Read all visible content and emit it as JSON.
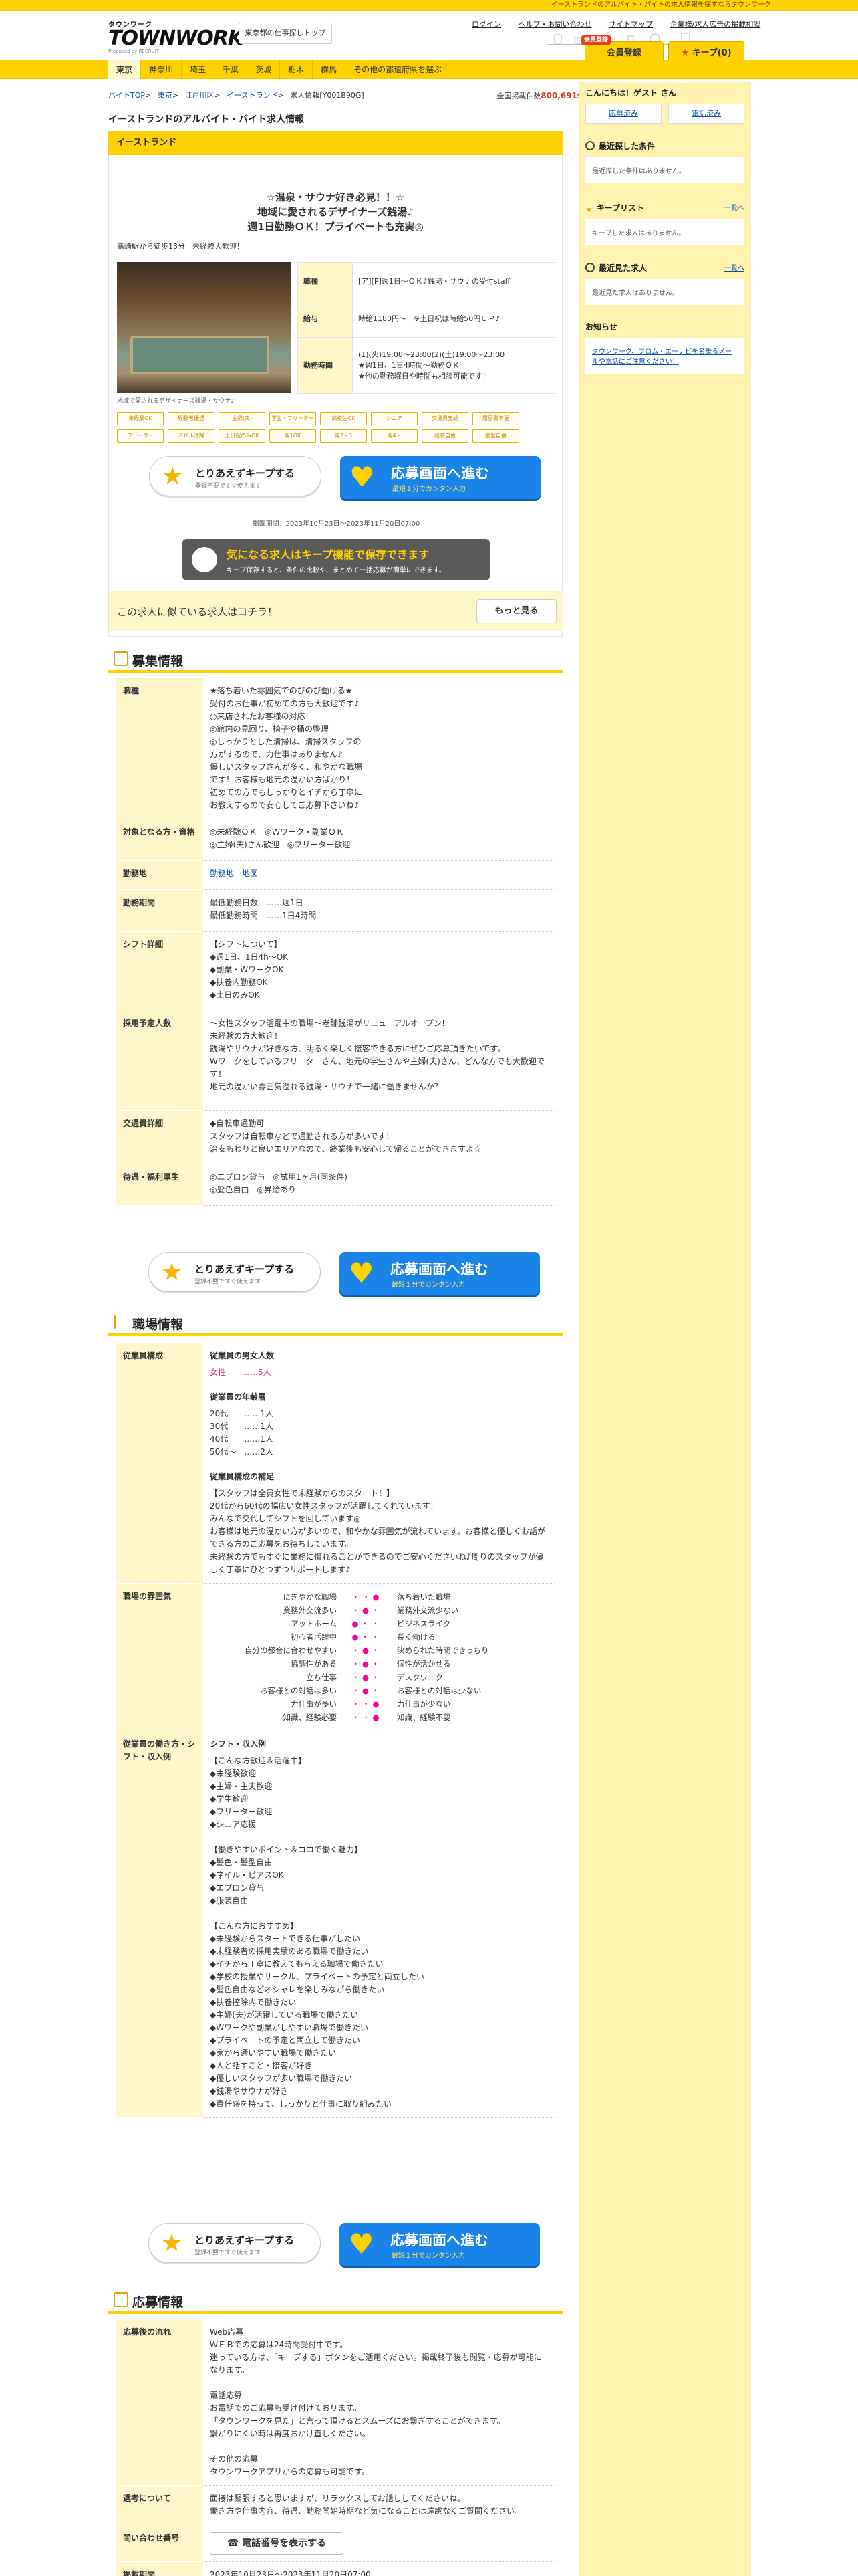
{
  "topbar": {
    "text": "イーストランドのアルバイト・パイトの求人情報を探すならタウンワーク"
  },
  "header": {
    "logo_top": "タウンワーク",
    "logo_main": "TOWNWORK",
    "logo_sub": "Produced by RECRUIT",
    "area_button": "東京都の仕事探しトップ",
    "links": [
      "ログイン",
      "ヘルプ・お問い合わせ",
      "サイトマップ",
      "企業様/求人広告の掲載相談"
    ],
    "register_badge": "会員登録",
    "register": "会員登録",
    "keep": "キープ(0)"
  },
  "nav": {
    "items": [
      "東京",
      "神奈川",
      "埼玉",
      "千葉",
      "茨城",
      "栃木",
      "群馬",
      "その他の都道府県を選ぶ"
    ]
  },
  "breadcrumb": [
    "バイトTOP",
    "東京",
    "江戸川区",
    "イーストランド",
    "求人情報[Y001B90G]"
  ],
  "count": {
    "label": "全国掲載件数",
    "value": "800,691件"
  },
  "page_title": "イーストランドのアルバイト・バイト求人情報",
  "job": {
    "company": "イーストランド",
    "headline": "☆温泉・サウナ好き必見！！☆\n地域に愛されるデザイナーズ銭湯♪\n週1日勤務ＯＫ！プライベートも充実◎",
    "location": "篠崎駅から徒歩13分　未経験大歓迎！",
    "photo_caption": "地域で愛されるデザイナーズ銭湯・サウナ♪",
    "summary": [
      {
        "label": "職種",
        "value": "[ア][P]週1日～ＯＫ♪銭湯・サウナの受付staff"
      },
      {
        "label": "給与",
        "value": "時給1180円～　※土日祝は時給50円ＵＰ♪"
      },
      {
        "label": "勤務時間",
        "value": "(1)(火)19:00～23:00(2)(土)19:00～23:00\n★週1日、1日4時間～勤務ＯＫ\n★他の勤務曜日や時間も相談可能です！"
      }
    ],
    "tags": [
      "未経験OK",
      "経験者優遇",
      "主婦(夫)",
      "学生・フリーター",
      "高校生OK",
      "シニア",
      "交通費支給",
      "履歴書不要",
      "フリーター",
      "ミドル活躍",
      "土日祝のみOK",
      "週1OK",
      "週2・3",
      "週4・",
      "服装自由",
      "髪型自由"
    ],
    "keep_button": "とりあえずキープする",
    "keep_sub": "登録不要ですぐ使えます",
    "apply_button": "応募画面へ進む",
    "apply_sub": "最短１分でカンタン入力",
    "published": "掲載期間：2023年10月23日～2023年11月20日07:00",
    "keep_banner_title": "気になる求人はキープ機能で保存できます",
    "keep_banner_sub": "キープ保存すると、条件の比較や、まとめて一括応募が簡単にできます。",
    "similar": "この求人に似ている求人はコチラ！",
    "similar_more": "もっと見る"
  },
  "recruit": {
    "title": "募集情報",
    "rows": [
      {
        "label": "職種",
        "value": "★落ち着いた雰囲気でのびのび働ける★\n受付のお仕事が初めての方も大歓迎です♪\n◎来店されたお客様の対応\n◎館内の見回り、椅子や桶の整理\n◎しっかりとした清掃は、清掃スタッフの\n方がするので、力仕事はありません♪\n優しいスタッフさんが多く、和やかな職場\nです！お客様も地元の温かい方ばかり！\n初めての方でもしっかりとイチから丁寧に\nお教えするので安心してご応募下さいね♪"
      },
      {
        "label": "対象となる方・資格",
        "value": "◎未経験ＯＫ　◎Ｗワーク・副業ＯＫ\n◎主婦(夫)さん歓迎　◎フリーター歓迎"
      },
      {
        "label": "勤務地",
        "value": "勤務地　地図"
      },
      {
        "label": "勤務期間",
        "value": "最低勤務日数　……週1日\n最低勤務時間　……1日4時間"
      },
      {
        "label": "シフト詳細",
        "value": "【シフトについて】\n◆週1日、1日4h～OK\n◆副業・WワークOK\n◆扶養内勤務OK\n◆土日のみOK"
      },
      {
        "label": "採用予定人数",
        "value": "～女性スタッフ活躍中の職場～老舗銭湯がリニューアルオープン！\n未経験の方大歓迎！\n銭湯やサウナが好きな方、明るく楽しく接客できる方にぜひご応募頂きたいです。\nWワークをしているフリーターさん、地元の学生さんや主婦(夫)さん、どんな方でも大歓迎です！\n地元の温かい雰囲気溢れる銭湯・サウナで一緒に働きませんか？"
      },
      {
        "label": "交通費詳細",
        "value": "◆自転車通勤可\nスタッフは自転車などで通勤される方が多いです！\n治安もわりと良いエリアなので、終業後も安心して帰ることができますよ☆"
      },
      {
        "label": "待遇・福利厚生",
        "value": "◎エプロン貸与　◎試用1ヶ月(同条件)\n◎髪色自由　◎昇給あり"
      }
    ]
  },
  "workplace": {
    "title": "職場情報",
    "staff_label": "従業員構成",
    "gender_title": "従業員の男女人数",
    "gender": "女性　　……5人",
    "age_title": "従業員の年齢層",
    "ages": "20代　　……1人\n30代　　……1人\n40代　　……1人\n50代～　……2人",
    "supp_title": "従業員構成の補足",
    "supp": "【スタッフは全員女性で未経験からのスタート！】\n20代から60代の幅広い女性スタッフが活躍してくれています！\nみんなで交代してシフトを回しています◎\nお客様は地元の温かい方が多いので、和やかな雰囲気が流れています。お客様と優しくお話ができる方のご応募をお待ちしています。\n未経験の方でもすぐに業務に慣れることができるのでご安心くださいね♪周りのスタッフが優しく丁寧にひとつずつサポートします♪",
    "atm_label": "職場の雰囲気",
    "atm": [
      {
        "l": "にぎやかな職場",
        "r": "落ち着いた職場"
      },
      {
        "l": "業務外交流多い",
        "r": "業務外交流少ない"
      },
      {
        "l": "アットホーム",
        "r": "ビジネスライク"
      },
      {
        "l": "初心者活躍中",
        "r": "長く働ける"
      },
      {
        "l": "自分の都合に合わせやすい",
        "r": "決められた時間できっちり"
      },
      {
        "l": "協調性がある",
        "r": "個性が活かせる"
      },
      {
        "l": "立ち仕事",
        "r": "デスクワーク"
      },
      {
        "l": "お客様との対話は多い",
        "r": "お客様との対話は少ない"
      },
      {
        "l": "力仕事が多い",
        "r": "力仕事が少ない"
      },
      {
        "l": "知識、経験必要",
        "r": "知識、経験不要"
      }
    ],
    "style_label": "従業員の働き方・シフト・収入例",
    "style_title": "シフト・収入例",
    "style": "【こんな方歓迎＆活躍中】\n◆未経験歓迎\n◆主婦・主夫歓迎\n◆学生歓迎\n◆フリーター歓迎\n◆シニア応援\n\n【働きやすいポイント＆ココで働く魅力】\n◆髪色・髪型自由\n◆ネイル・ピアスOK\n◆エプロン貸与\n◆服装自由\n\n【こんな方におすすめ】\n◆未経験からスタートできる仕事がしたい\n◆未経験者の採用実績のある職場で働きたい\n◆イチから丁寧に教えてもらえる職場で働きたい\n◆学校の授業やサークル、プライベートの予定と両立したい\n◆髪色自由などオシャレを楽しみながら働きたい\n◆扶養控除内で働きたい\n◆主婦(夫)が活躍している職場で働きたい\n◆Wワークや副業がしやすい職場で働きたい\n◆プライベートの予定と両立して働きたい\n◆家から通いやすい職場で働きたい\n◆人と話すこと・接客が好き\n◆優しいスタッフが多い職場で働きたい\n◆銭湯やサウナが好き\n◆責任感を持って、しっかりと仕事に取り組みたい"
  },
  "apply": {
    "title": "応募情報",
    "rows": [
      {
        "label": "応募後の流れ",
        "value": "Web応募\nＷＥＢでの応募は24時間受付中です。\n迷っている方は、「キープする」ボタンをご活用ください。掲載終了後も閲覧・応募が可能になります。\n\n電話応募\nお電話でのご応募も受け付けております。\n「タウンワークを見た」と言って頂けるとスムーズにお繋ぎすることができます。\n繋がりにくい時は再度おかけ直しください。\n\nその他の応募\nタウンワークアプリからの応募も可能です。"
      },
      {
        "label": "選考について",
        "value": "面接は緊張すると思いますが、リラックスしてお話ししてくださいね。\n働き方や仕事内容、待遇、勤務開始時期など気になることは遠慮なくご質問ください。"
      },
      {
        "label": "問い合わせ番号",
        "value": "電話番号を表示する"
      },
      {
        "label": "掲載期間",
        "value": "2023年10月23日～2023年11月20日07:00"
      }
    ]
  },
  "sidebar": {
    "greeting": "こんにちは！ゲスト さん",
    "guest": "ゲスト",
    "btn_keep": "応募済み",
    "btn_tel": "電話済み",
    "recent_cond_title": "最近探した条件",
    "recent_cond_empty": "最近探した条件はありません。",
    "keep_title": "キープリスト",
    "keep_link": "一覧へ",
    "keep_empty": "キープした求人はありません。",
    "recent_job_title": "最近見た求人",
    "recent_job_link": "一覧へ",
    "recent_job_empty": "最近見た求人はありません。",
    "notice_title": "お知らせ",
    "notice_link": "タウンワーク、フロム・エーナビを名乗るメールや電話にご注意ください！"
  }
}
